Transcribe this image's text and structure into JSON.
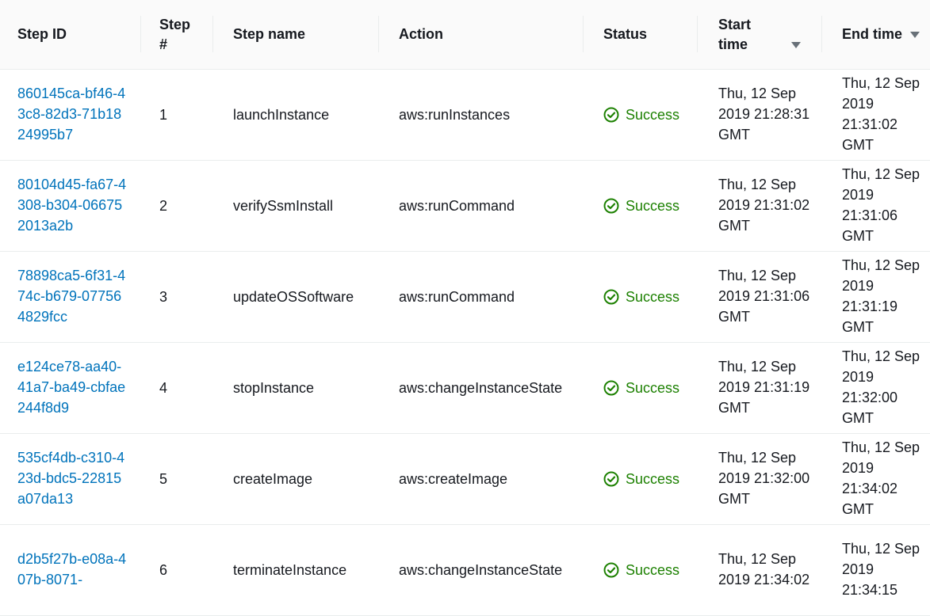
{
  "headers": {
    "step_id": "Step ID",
    "step_num": "Step #",
    "step_name": "Step name",
    "action": "Action",
    "status": "Status",
    "start_time": "Start time",
    "end_time": "End time"
  },
  "colors": {
    "link": "#0073bb",
    "success": "#1d8102",
    "header_bg": "#fafafa"
  },
  "rows": [
    {
      "id": "860145ca-bf46-43c8-82d3-71b1824995b7",
      "num": "1",
      "name": "launchInstance",
      "action": "aws:runInstances",
      "status": "Success",
      "start": "Thu, 12 Sep 2019 21:28:31 GMT",
      "end": "Thu, 12 Sep 2019 21:31:02 GMT"
    },
    {
      "id": "80104d45-fa67-4308-b304-066752013a2b",
      "num": "2",
      "name": "verifySsmInstall",
      "action": "aws:runCommand",
      "status": "Success",
      "start": "Thu, 12 Sep 2019 21:31:02 GMT",
      "end": "Thu, 12 Sep 2019 21:31:06 GMT"
    },
    {
      "id": "78898ca5-6f31-474c-b679-077564829fcc",
      "num": "3",
      "name": "updateOSSoftware",
      "action": "aws:runCommand",
      "status": "Success",
      "start": "Thu, 12 Sep 2019 21:31:06 GMT",
      "end": "Thu, 12 Sep 2019 21:31:19 GMT"
    },
    {
      "id": "e124ce78-aa40-41a7-ba49-cbfae244f8d9",
      "num": "4",
      "name": "stopInstance",
      "action": "aws:changeInstanceState",
      "status": "Success",
      "start": "Thu, 12 Sep 2019 21:31:19 GMT",
      "end": "Thu, 12 Sep 2019 21:32:00 GMT"
    },
    {
      "id": "535cf4db-c310-423d-bdc5-22815a07da13",
      "num": "5",
      "name": "createImage",
      "action": "aws:createImage",
      "status": "Success",
      "start": "Thu, 12 Sep 2019 21:32:00 GMT",
      "end": "Thu, 12 Sep 2019 21:34:02 GMT"
    },
    {
      "id": "d2b5f27b-e08a-407b-8071-",
      "num": "6",
      "name": "terminateInstance",
      "action": "aws:changeInstanceState",
      "status": "Success",
      "start": "Thu, 12 Sep 2019 21:34:02",
      "end": "Thu, 12 Sep 2019 21:34:15"
    }
  ]
}
